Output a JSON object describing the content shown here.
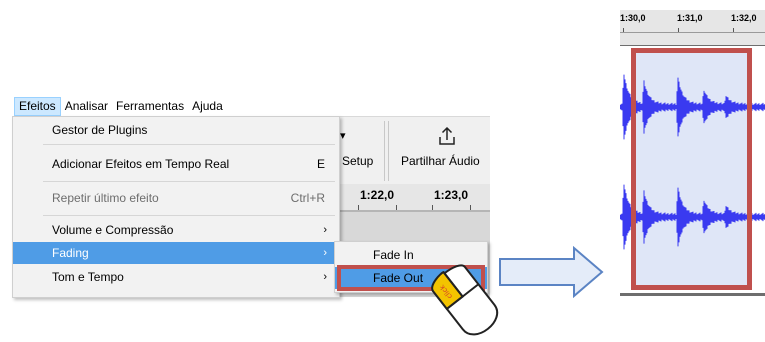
{
  "menubar": {
    "items": [
      "Efeitos",
      "Analisar",
      "Ferramentas",
      "Ajuda"
    ]
  },
  "toolbar": {
    "setup_label": "Setup",
    "share_label": "Partilhar Áudio"
  },
  "timeline": {
    "labels": [
      "1:22,0",
      "1:23,0"
    ]
  },
  "menu": {
    "items": [
      {
        "label": "Gestor de Plugins",
        "shortcut": ""
      },
      {
        "label": "Adicionar Efeitos em Tempo Real",
        "shortcut": "E"
      },
      {
        "label": "Repetir último efeito",
        "shortcut": "Ctrl+R"
      },
      {
        "label": "Volume e Compressão",
        "shortcut": ""
      },
      {
        "label": "Fading",
        "shortcut": ""
      },
      {
        "label": "Tom e Tempo",
        "shortcut": ""
      }
    ]
  },
  "submenu": {
    "items": [
      "Fade In",
      "Fade Out"
    ]
  },
  "mouse": {
    "button_label": "click"
  },
  "waveform": {
    "ruler_labels": [
      "1:30,0",
      "1:31,0",
      "1:32,0"
    ]
  },
  "colors": {
    "highlight": "#4f9ce6",
    "annotation_box": "#c0504d",
    "arrow_fill": "#e4ecf9",
    "arrow_stroke": "#5b84c4",
    "waveform": "#3a3af0"
  }
}
